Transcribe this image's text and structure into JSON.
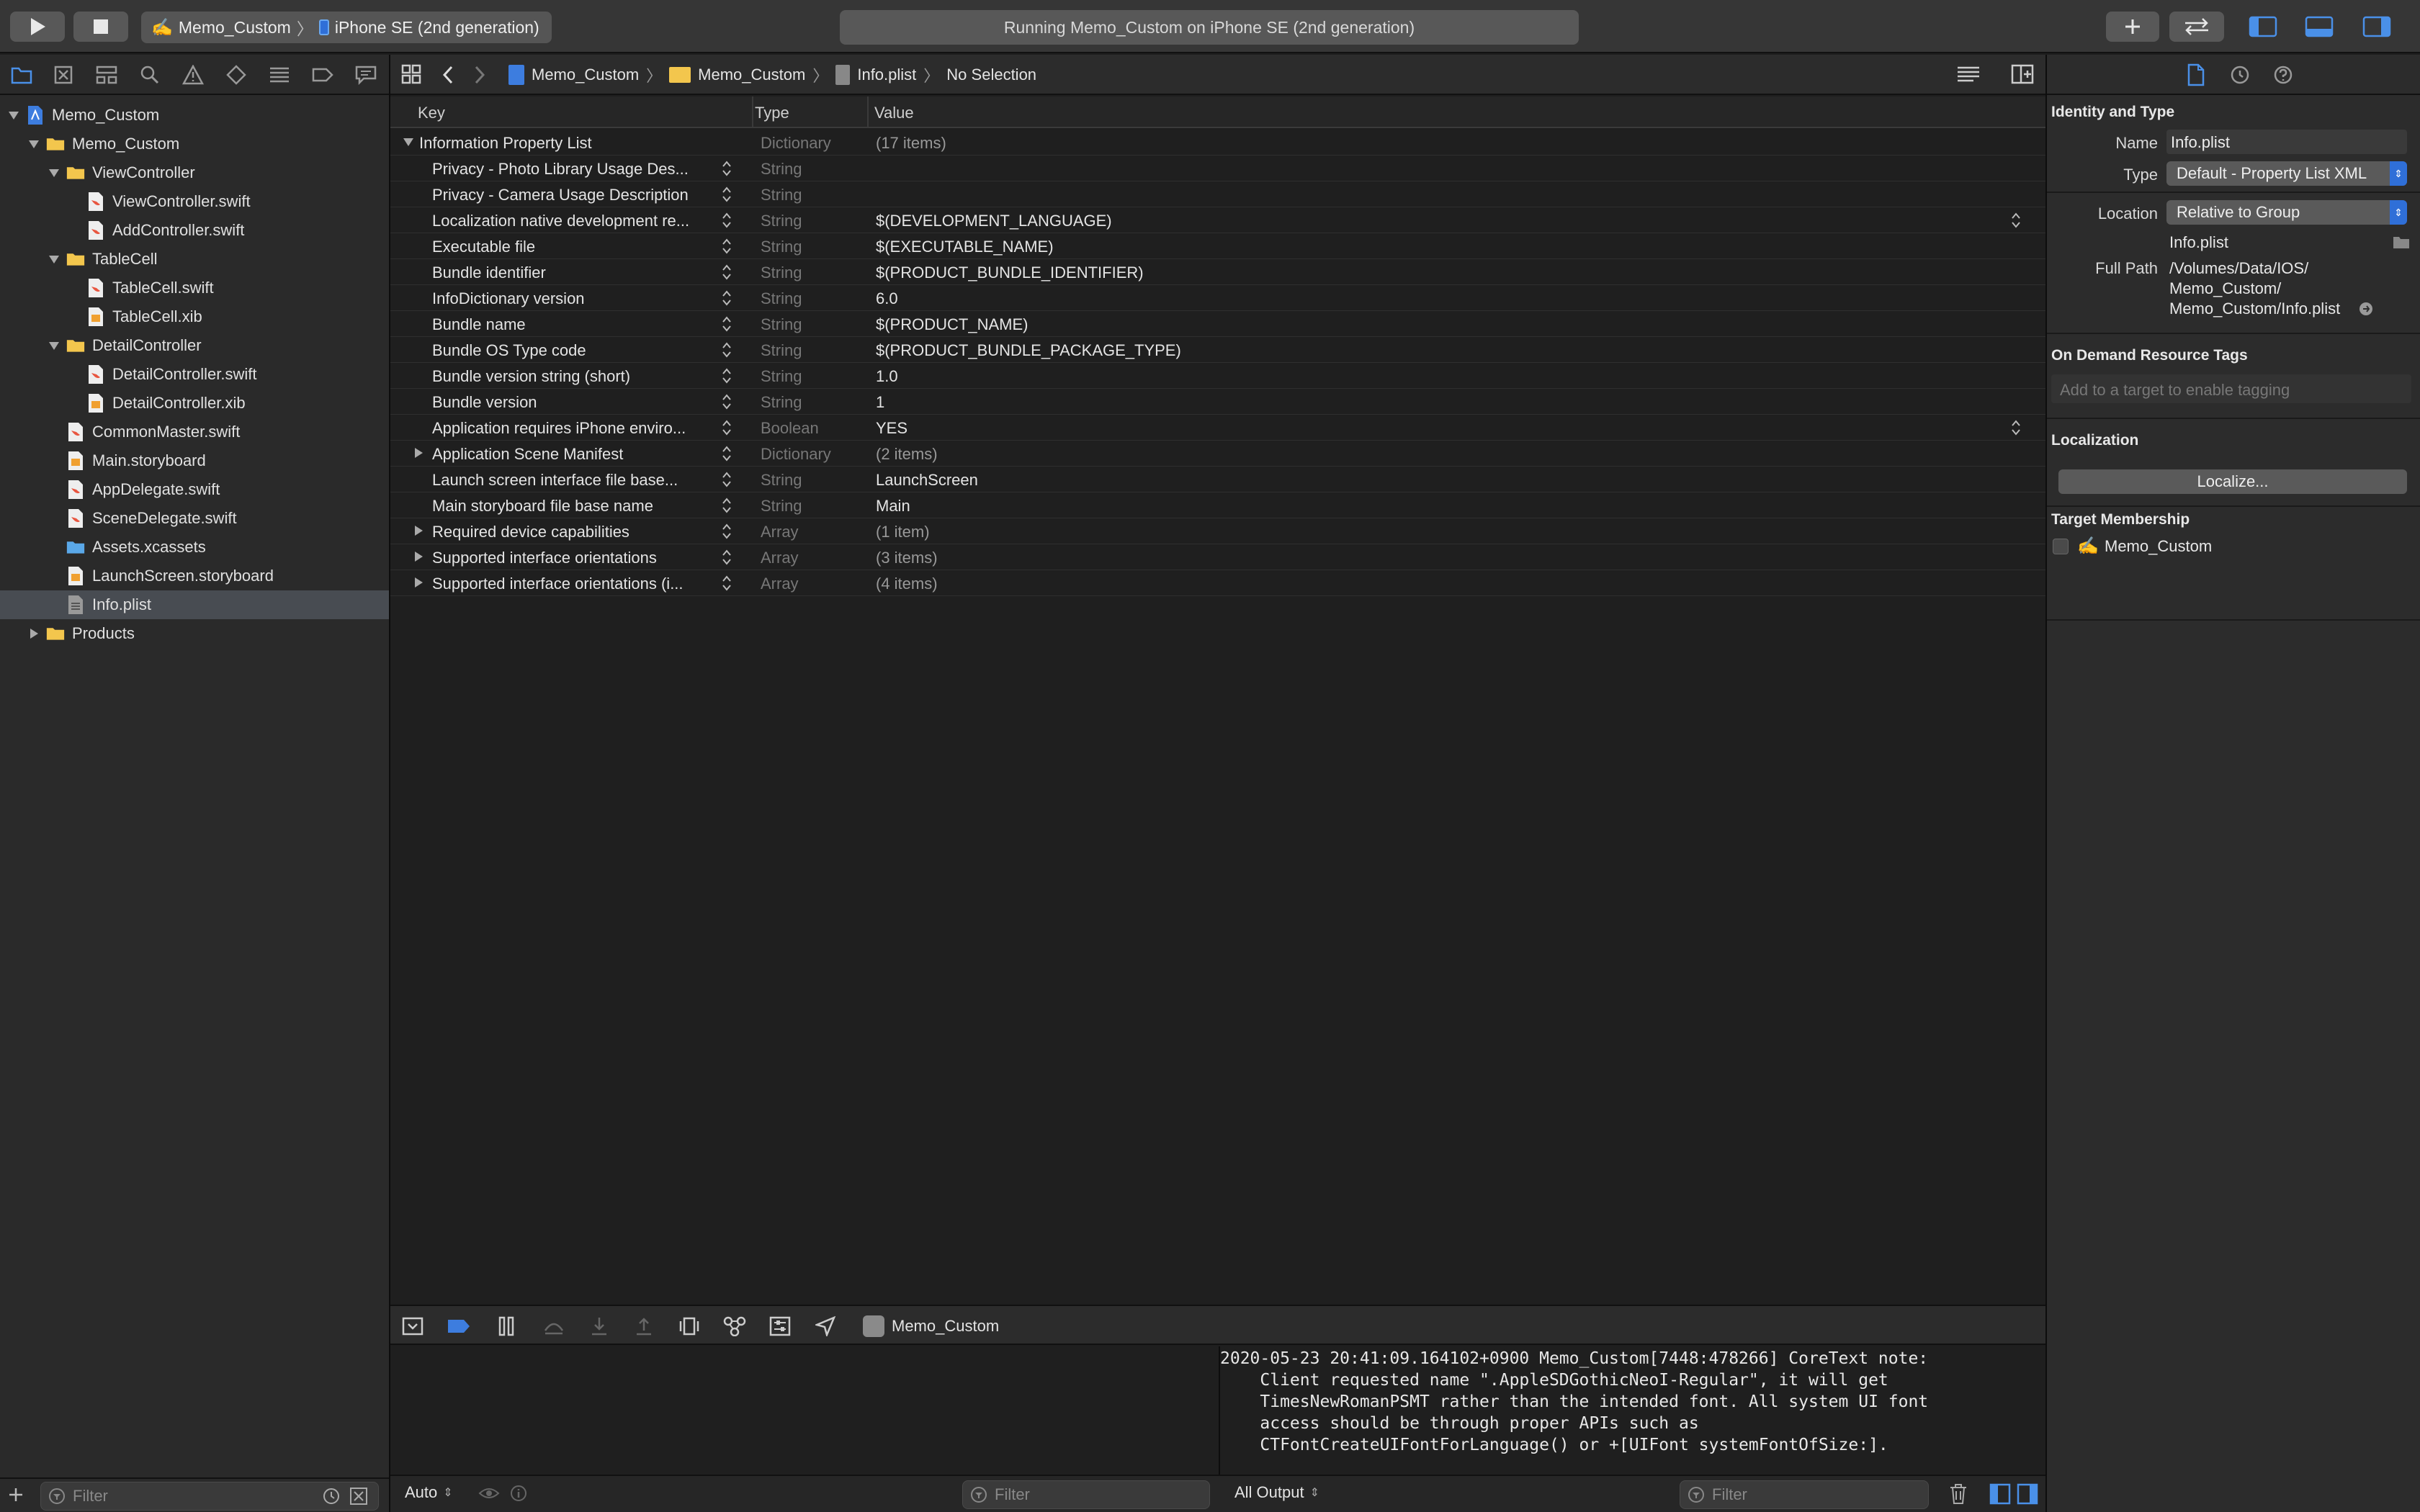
{
  "toolbar": {
    "scheme_name": "Memo_Custom",
    "device_name": "iPhone SE (2nd generation)",
    "activity_text": "Running Memo_Custom on iPhone SE (2nd generation)"
  },
  "navigator": {
    "items": [
      {
        "label": "Memo_Custom",
        "kind": "project",
        "disclosure": "open"
      },
      {
        "label": "Memo_Custom",
        "kind": "folder",
        "disclosure": "open"
      },
      {
        "label": "ViewController",
        "kind": "folder",
        "disclosure": "open"
      },
      {
        "label": "ViewController.swift",
        "kind": "swift"
      },
      {
        "label": "AddController.swift",
        "kind": "swift"
      },
      {
        "label": "TableCell",
        "kind": "folder",
        "disclosure": "open"
      },
      {
        "label": "TableCell.swift",
        "kind": "swift"
      },
      {
        "label": "TableCell.xib",
        "kind": "xib"
      },
      {
        "label": "DetailController",
        "kind": "folder",
        "disclosure": "open"
      },
      {
        "label": "DetailController.swift",
        "kind": "swift"
      },
      {
        "label": "DetailController.xib",
        "kind": "xib"
      },
      {
        "label": "CommonMaster.swift",
        "kind": "swift"
      },
      {
        "label": "Main.storyboard",
        "kind": "xib"
      },
      {
        "label": "AppDelegate.swift",
        "kind": "swift"
      },
      {
        "label": "SceneDelegate.swift",
        "kind": "swift"
      },
      {
        "label": "Assets.xcassets",
        "kind": "assets"
      },
      {
        "label": "LaunchScreen.storyboard",
        "kind": "xib"
      },
      {
        "label": "Info.plist",
        "kind": "plist",
        "selected": true
      },
      {
        "label": "Products",
        "kind": "folder",
        "disclosure": "closed"
      }
    ],
    "filter_placeholder": "Filter"
  },
  "jumpbar": {
    "project": "Memo_Custom",
    "group": "Memo_Custom",
    "file": "Info.plist",
    "selection": "No Selection"
  },
  "plist": {
    "headers": {
      "key": "Key",
      "type": "Type",
      "value": "Value"
    },
    "root": {
      "key": "Information Property List",
      "type": "Dictionary",
      "value": "(17 items)"
    },
    "rows": [
      {
        "key": "Privacy - Photo Library Usage Des...",
        "type": "String",
        "value": ""
      },
      {
        "key": "Privacy - Camera Usage Description",
        "type": "String",
        "value": ""
      },
      {
        "key": "Localization native development re...",
        "type": "String",
        "value": "$(DEVELOPMENT_LANGUAGE)",
        "popup": true
      },
      {
        "key": "Executable file",
        "type": "String",
        "value": "$(EXECUTABLE_NAME)"
      },
      {
        "key": "Bundle identifier",
        "type": "String",
        "value": "$(PRODUCT_BUNDLE_IDENTIFIER)"
      },
      {
        "key": "InfoDictionary version",
        "type": "String",
        "value": "6.0"
      },
      {
        "key": "Bundle name",
        "type": "String",
        "value": "$(PRODUCT_NAME)"
      },
      {
        "key": "Bundle OS Type code",
        "type": "String",
        "value": "$(PRODUCT_BUNDLE_PACKAGE_TYPE)"
      },
      {
        "key": "Bundle version string (short)",
        "type": "String",
        "value": "1.0"
      },
      {
        "key": "Bundle version",
        "type": "String",
        "value": "1"
      },
      {
        "key": "Application requires iPhone enviro...",
        "type": "Boolean",
        "value": "YES",
        "popup": true
      },
      {
        "key": "Application Scene Manifest",
        "type": "Dictionary",
        "value": "(2 items)",
        "expandable": true
      },
      {
        "key": "Launch screen interface file base...",
        "type": "String",
        "value": "LaunchScreen"
      },
      {
        "key": "Main storyboard file base name",
        "type": "String",
        "value": "Main"
      },
      {
        "key": "Required device capabilities",
        "type": "Array",
        "value": "(1 item)",
        "expandable": true
      },
      {
        "key": "Supported interface orientations",
        "type": "Array",
        "value": "(3 items)",
        "expandable": true
      },
      {
        "key": "Supported interface orientations (i...",
        "type": "Array",
        "value": "(4 items)",
        "expandable": true
      }
    ]
  },
  "debug": {
    "target_name": "Memo_Custom",
    "auto_label": "Auto",
    "vars_filter_placeholder": "Filter",
    "output_label": "All Output",
    "console_filter_placeholder": "Filter",
    "console_lines": [
      "2020-05-23 20:41:09.164102+0900 Memo_Custom[7448:478266] CoreText note:",
      "    Client requested name \".AppleSDGothicNeoI-Regular\", it will get",
      "    TimesNewRomanPSMT rather than the intended font. All system UI font",
      "    access should be through proper APIs such as",
      "    CTFontCreateUIFontForLanguage() or +[UIFont systemFontOfSize:]."
    ]
  },
  "inspector": {
    "identity_title": "Identity and Type",
    "name_label": "Name",
    "name_value": "Info.plist",
    "type_label": "Type",
    "type_value": "Default - Property List XML",
    "location_label": "Location",
    "location_value": "Relative to Group",
    "location_file": "Info.plist",
    "fullpath_label": "Full Path",
    "fullpath_lines": [
      "/Volumes/Data/IOS/",
      "Memo_Custom/",
      "Memo_Custom/Info.plist"
    ],
    "odr_title": "On Demand Resource Tags",
    "odr_placeholder": "Add to a target to enable tagging",
    "localization_title": "Localization",
    "localize_button": "Localize...",
    "membership_title": "Target Membership",
    "membership_target": "Memo_Custom"
  },
  "colors": {
    "accent": "#2f6fd8",
    "selection": "#484c52",
    "folder": "#f3c64d",
    "swift": "#e8553f"
  }
}
